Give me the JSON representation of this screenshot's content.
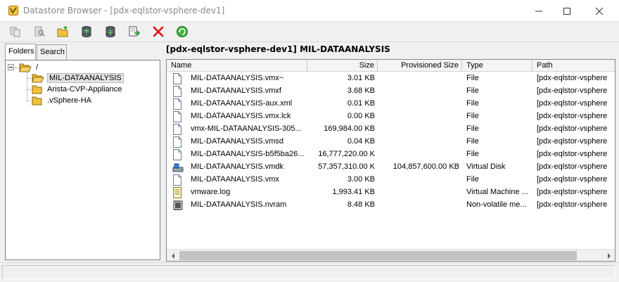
{
  "window": {
    "title": "Datastore Browser - [pdx-eqlstor-vsphere-dev1]",
    "icon": "vsphere-app-icon",
    "controls": [
      "minimize-icon",
      "maximize-icon",
      "close-icon"
    ]
  },
  "toolbar": {
    "buttons": [
      {
        "icon": "copy-icon",
        "enabled": false
      },
      {
        "icon": "search-datastore-icon",
        "enabled": false
      },
      {
        "icon": "new-folder-icon",
        "enabled": true
      },
      {
        "icon": "upload-icon",
        "enabled": true
      },
      {
        "icon": "download-icon",
        "enabled": true
      },
      {
        "icon": "register-vm-icon",
        "enabled": true
      },
      {
        "icon": "delete-icon",
        "enabled": true,
        "color": "#e01010"
      },
      {
        "icon": "refresh-icon",
        "enabled": true,
        "color": "#2e9e2e"
      }
    ]
  },
  "left_panel": {
    "tabs": [
      {
        "label": "Folders",
        "active": true
      },
      {
        "label": "Search",
        "active": false
      }
    ],
    "tree": {
      "root": "/",
      "children": [
        {
          "label": "MIL-DATAANALYSIS",
          "selected": true
        },
        {
          "label": "Arista-CVP-Appliance",
          "selected": false
        },
        {
          "label": ".vSphere-HA",
          "selected": false
        }
      ]
    }
  },
  "right_panel": {
    "path": "[pdx-eqlstor-vsphere-dev1] MIL-DATAANALYSIS",
    "columns": [
      "Name",
      "Size",
      "Provisioned Size",
      "Type",
      "Path"
    ],
    "rows": [
      {
        "icon": "file-icon",
        "name": "MIL-DATAANALYSIS.vmx~",
        "size": "3.01 KB",
        "provisioned": "",
        "type": "File",
        "path": "[pdx-eqlstor-vsphere"
      },
      {
        "icon": "file-icon",
        "name": "MIL-DATAANALYSIS.vmxf",
        "size": "3.68 KB",
        "provisioned": "",
        "type": "File",
        "path": "[pdx-eqlstor-vsphere"
      },
      {
        "icon": "file-icon",
        "name": "MIL-DATAANALYSIS-aux.xml",
        "size": "0.01 KB",
        "provisioned": "",
        "type": "File",
        "path": "[pdx-eqlstor-vsphere"
      },
      {
        "icon": "file-icon",
        "name": "MIL-DATAANALYSIS.vmx.lck",
        "size": "0.00 KB",
        "provisioned": "",
        "type": "File",
        "path": "[pdx-eqlstor-vsphere"
      },
      {
        "icon": "file-icon",
        "name": "vmx-MIL-DATAANALYSIS-305...",
        "size": "169,984.00 KB",
        "provisioned": "",
        "type": "File",
        "path": "[pdx-eqlstor-vsphere"
      },
      {
        "icon": "file-icon",
        "name": "MIL-DATAANALYSIS.vmsd",
        "size": "0.04 KB",
        "provisioned": "",
        "type": "File",
        "path": "[pdx-eqlstor-vsphere"
      },
      {
        "icon": "file-icon",
        "name": "MIL-DATAANALYSIS-b5f5ba26...",
        "size": "16,777,220.00 K",
        "provisioned": "",
        "type": "File",
        "path": "[pdx-eqlstor-vsphere"
      },
      {
        "icon": "virtual-disk-icon",
        "name": "MIL-DATAANALYSIS.vmdk",
        "size": "57,357,310.00 K",
        "provisioned": "104,857,600.00 KB",
        "type": "Virtual Disk",
        "path": "[pdx-eqlstor-vsphere"
      },
      {
        "icon": "file-icon",
        "name": "MIL-DATAANALYSIS.vmx",
        "size": "3.00 KB",
        "provisioned": "",
        "type": "File",
        "path": "[pdx-eqlstor-vsphere"
      },
      {
        "icon": "log-file-icon",
        "name": "vmware.log",
        "size": "1,993.41 KB",
        "provisioned": "",
        "type": "Virtual Machine ...",
        "path": "[pdx-eqlstor-vsphere"
      },
      {
        "icon": "nvram-icon",
        "name": "MIL-DATAANALYSIS.nvram",
        "size": "8.48 KB",
        "provisioned": "",
        "type": "Non-volatile me...",
        "path": "[pdx-eqlstor-vsphere"
      }
    ]
  },
  "status_bar": {
    "text": ""
  }
}
